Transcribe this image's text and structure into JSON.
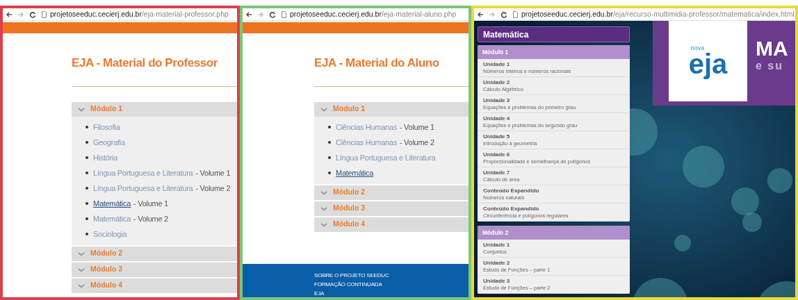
{
  "windows": [
    {
      "kind": "material",
      "color": "#d9414f",
      "url_host": "projetoseeduc.cecierj.edu.br",
      "url_path": "/eja-material-professor.php",
      "title": "EJA - Material do Professor",
      "modules": [
        {
          "label": "Módulo 1",
          "expanded": true,
          "items": [
            {
              "link": "Filosofia",
              "hovered": false
            },
            {
              "link": "Geografia",
              "hovered": false
            },
            {
              "link": "História",
              "hovered": false
            },
            {
              "link": "Língua Portuguesa e Literatura",
              "suffix": "- Volume 1",
              "hovered": false
            },
            {
              "link": "Língua Portuguesa e Literatura",
              "suffix": "- Volume 2",
              "hovered": false
            },
            {
              "link": "Matemática",
              "suffix": "- Volume 1",
              "hovered": true
            },
            {
              "link": "Matemática",
              "suffix": "- Volume 2",
              "hovered": false
            },
            {
              "link": "Sociologia",
              "hovered": false
            }
          ]
        },
        {
          "label": "Módulo 2",
          "expanded": false
        },
        {
          "label": "Módulo 3",
          "expanded": false
        },
        {
          "label": "Módulo 4",
          "expanded": false
        }
      ]
    },
    {
      "kind": "material",
      "color": "#7cc576",
      "url_host": "projetoseeduc.cecierj.edu.br",
      "url_path": "/eja-material-aluno.php",
      "title": "EJA - Material do Aluno",
      "modules": [
        {
          "label": "Módulo 1",
          "expanded": true,
          "items": [
            {
              "link": "Ciências Humanas",
              "suffix": "- Volume 1",
              "hovered": false
            },
            {
              "link": "Ciências Humanas",
              "suffix": "- Volume 2",
              "hovered": false
            },
            {
              "link": "Língua Portuguesa e Literatura",
              "hovered": false
            },
            {
              "link": "Matemática",
              "hovered": true
            }
          ]
        },
        {
          "label": "Módulo 2",
          "expanded": false
        },
        {
          "label": "Módulo 3",
          "expanded": false
        },
        {
          "label": "Módulo 4",
          "expanded": false
        }
      ],
      "footer_links": [
        "SOBRE O PROJETO SEEDUC",
        "FORMAÇÃO CONTINUADA",
        "EJA"
      ]
    },
    {
      "kind": "multimedia",
      "color": "#e6dc3c",
      "url_host": "projetoseeduc.cecierj.edu.br",
      "url_path": "/eja/recurso-multimidia-professor/matematica/index.html",
      "menu": {
        "title": "Matemática",
        "modules": [
          {
            "label": "Módulo 1",
            "units": [
              {
                "title": "Unidade 1",
                "subtitle": "Números inteiros e números racionais"
              },
              {
                "title": "Unidade 2",
                "subtitle": "Cálculo Algébrico"
              },
              {
                "title": "Unidade 3",
                "subtitle": "Equações e problemas do primeiro grau"
              },
              {
                "title": "Unidade 4",
                "subtitle": "Equações e problemas do segundo grau"
              },
              {
                "title": "Unidade 5",
                "subtitle": "Introdução à geometria"
              },
              {
                "title": "Unidade 6",
                "subtitle": "Proporcionalidade e semelhança de polígonos"
              },
              {
                "title": "Unidade 7",
                "subtitle": "Cálculo de área"
              },
              {
                "title": "Conteúdo Expandido",
                "subtitle": "Números naturais"
              },
              {
                "title": "Conteúdo Expandido",
                "subtitle": "Circunferência e polígonos regulares"
              }
            ]
          },
          {
            "label": "Módulo 2",
            "units": [
              {
                "title": "Unidade 1",
                "subtitle": "Conjuntos"
              },
              {
                "title": "Unidade 2",
                "subtitle": "Estudo de Funções – parte 1"
              },
              {
                "title": "Unidade 3",
                "subtitle": "Estudo de Funções – parte 2"
              }
            ]
          }
        ]
      },
      "banner": {
        "logo_top": "nova",
        "logo_main": "eja",
        "title": "MA",
        "subtitle": "e su"
      }
    }
  ]
}
